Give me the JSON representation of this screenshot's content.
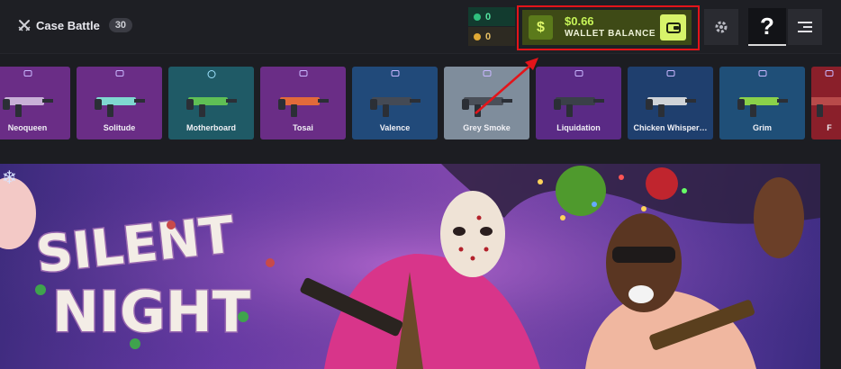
{
  "header": {
    "case_battle": {
      "label": "Case Battle",
      "count": "30"
    },
    "balances": [
      {
        "value": "0",
        "color": "#2fbf7d"
      },
      {
        "value": "0",
        "color": "#e0a935"
      }
    ],
    "wallet": {
      "currency_symbol": "$",
      "amount": "$0.66",
      "label": "WALLET BALANCE"
    },
    "help_glyph": "?"
  },
  "cases": [
    {
      "name": "Neoqueen",
      "bg": "#6a2d86",
      "icon": "box-icon",
      "gun": "#c9b0d8"
    },
    {
      "name": "Solitude",
      "bg": "#6a2d86",
      "icon": "box-icon",
      "gun": "#7fd8d0"
    },
    {
      "name": "Motherboard",
      "bg": "#1f5a66",
      "icon": "ring-icon",
      "gun": "#5fbf55"
    },
    {
      "name": "Tosai",
      "bg": "#6a2d86",
      "icon": "box-icon",
      "gun": "#e26a3a"
    },
    {
      "name": "Valence",
      "bg": "#214a7a",
      "icon": "box-icon",
      "gun": "#444a55"
    },
    {
      "name": "Grey Smoke",
      "bg": "#7f8d9c",
      "icon": "box-icon",
      "gun": "#4a4f58"
    },
    {
      "name": "Liquidation",
      "bg": "#5a2a85",
      "icon": "box-icon",
      "gun": "#3a4048"
    },
    {
      "name": "Chicken Whisper…",
      "bg": "#1f3f6e",
      "icon": "box-icon",
      "gun": "#cfd3d8"
    },
    {
      "name": "Grim",
      "bg": "#1f4f78",
      "icon": "box-icon",
      "gun": "#8ad14a"
    },
    {
      "name": "F",
      "bg": "#8a1f2a",
      "icon": "box-icon",
      "gun": "#b84a4a"
    }
  ],
  "banner": {
    "title_line1": "SILENT",
    "title_line2": "NIGHT"
  }
}
